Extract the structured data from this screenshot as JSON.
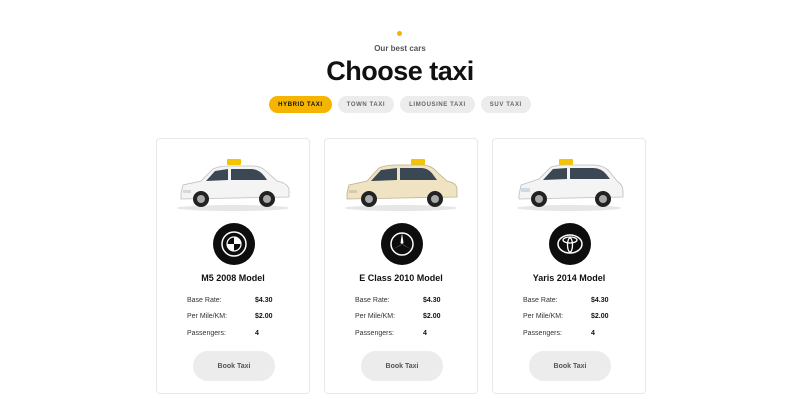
{
  "section": {
    "eyebrow": "Our best cars",
    "title": "Choose taxi"
  },
  "tabs": [
    {
      "label": "HYBRID TAXI",
      "active": true
    },
    {
      "label": "TOWN TAXI",
      "active": false
    },
    {
      "label": "LIMOUSINE TAXI",
      "active": false
    },
    {
      "label": "SUV TAXI",
      "active": false
    }
  ],
  "spec_labels": {
    "base_rate": "Base Rate:",
    "per_mile": "Per Mile/KM:",
    "passengers": "Passengers:"
  },
  "cars": [
    {
      "model": "M5 2008 Model",
      "brand_icon": "bmw-logo-icon",
      "car_color": "#f4f4f4",
      "base_rate": "$4.30",
      "per_mile": "$2.00",
      "passengers": "4",
      "button": "Book Taxi"
    },
    {
      "model": "E Class 2010 Model",
      "brand_icon": "mercedes-logo-icon",
      "car_color": "#efe3c4",
      "base_rate": "$4.30",
      "per_mile": "$2.00",
      "passengers": "4",
      "button": "Book Taxi"
    },
    {
      "model": "Yaris 2014 Model",
      "brand_icon": "toyota-logo-icon",
      "car_color": "#f4f4f4",
      "base_rate": "$4.30",
      "per_mile": "$2.00",
      "passengers": "4",
      "button": "Book Taxi"
    }
  ],
  "colors": {
    "accent": "#f5b400",
    "tab_inactive": "#ececec",
    "brand_circle": "#0d0d0d"
  }
}
